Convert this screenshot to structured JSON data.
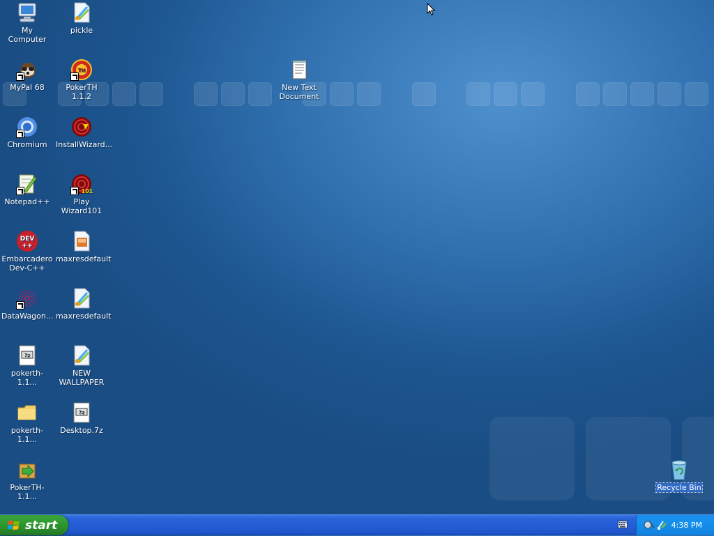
{
  "desktop": {
    "icons": [
      {
        "label": "My Computer",
        "icon": "computer-icon"
      },
      {
        "label": "pickle",
        "icon": "image-file-icon"
      },
      {
        "label": "MyPal 68",
        "icon": "mypal-icon"
      },
      {
        "label": "PokerTH 1.1.2",
        "icon": "pokerth-icon"
      },
      {
        "label": "New Text Document",
        "icon": "text-document-icon"
      },
      {
        "label": "Chromium",
        "icon": "chromium-icon"
      },
      {
        "label": "InstallWizard...",
        "icon": "install-wizard-icon"
      },
      {
        "label": "Notepad++",
        "icon": "notepadpp-icon"
      },
      {
        "label": "Play Wizard101",
        "icon": "wizard101-icon"
      },
      {
        "label": "Embarcadero Dev-C++",
        "icon": "devcpp-icon"
      },
      {
        "label": "maxresdefault",
        "icon": "image-file-icon"
      },
      {
        "label": "DataWagon...",
        "icon": "datawagon-icon"
      },
      {
        "label": "maxresdefault",
        "icon": "image-file-icon"
      },
      {
        "label": "pokerth-1.1...",
        "icon": "archive-file-icon"
      },
      {
        "label": "NEW WALLPAPER",
        "icon": "image-file-icon"
      },
      {
        "label": "pokerth-1.1...",
        "icon": "folder-icon"
      },
      {
        "label": "Desktop.7z",
        "icon": "archive-file-icon"
      },
      {
        "label": "PokerTH-1.1...",
        "icon": "installer-icon"
      },
      {
        "label": "Recycle Bin",
        "icon": "recycle-bin-icon"
      }
    ]
  },
  "taskbar": {
    "start_label": "start",
    "clock": "4:38 PM"
  },
  "colors": {
    "desktop": "#2f6fae",
    "taskbar": "#245dd6",
    "start_button": "#2f9a2f",
    "tray": "#1590ec",
    "selection": "#316ac5"
  }
}
